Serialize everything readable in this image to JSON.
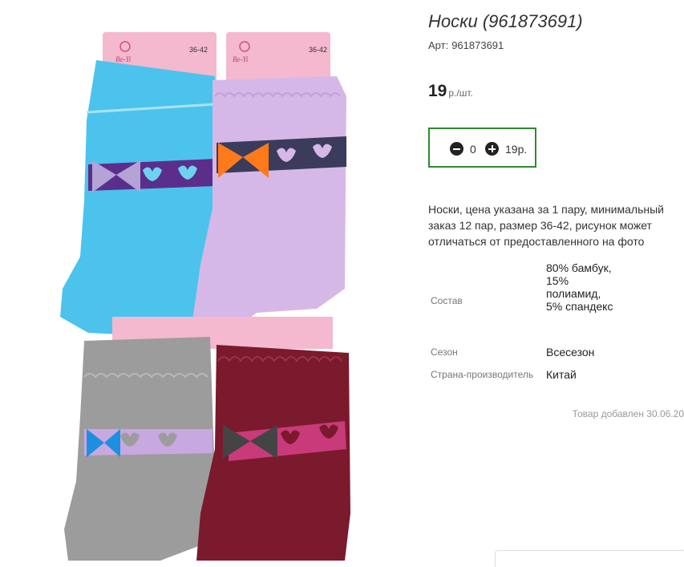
{
  "product": {
    "title": "Носки (961873691)",
    "sku_label": "Арт:",
    "sku_value": "961873691",
    "price": "19",
    "price_unit": "р./шт.",
    "quantity": "0",
    "total": "19р.",
    "description": "Носки, цена указана за 1 пару, минимальный заказ 12 пар, размер 36-42, рисунок может отличаться от предоставленного на фото",
    "specs": [
      {
        "label": "Состав",
        "value": "80% бамбук, 15% полиамид, 5% спандекс"
      },
      {
        "label": "Сезон",
        "value": "Всесезон"
      },
      {
        "label": "Страна-производитель",
        "value": "Китай"
      }
    ],
    "added_date": "Товар добавлен 30.06.20"
  },
  "image": {
    "tag_size": "36-42",
    "brand": "Be-Yi"
  },
  "colors": {
    "accent_border": "#2e8b2e",
    "sock_blue": "#4cc3ec",
    "sock_lilac": "#d6b8e8",
    "sock_gray": "#9c9c9c",
    "sock_burgundy": "#7a1a2c",
    "tag_pink": "#f4b8cf"
  }
}
